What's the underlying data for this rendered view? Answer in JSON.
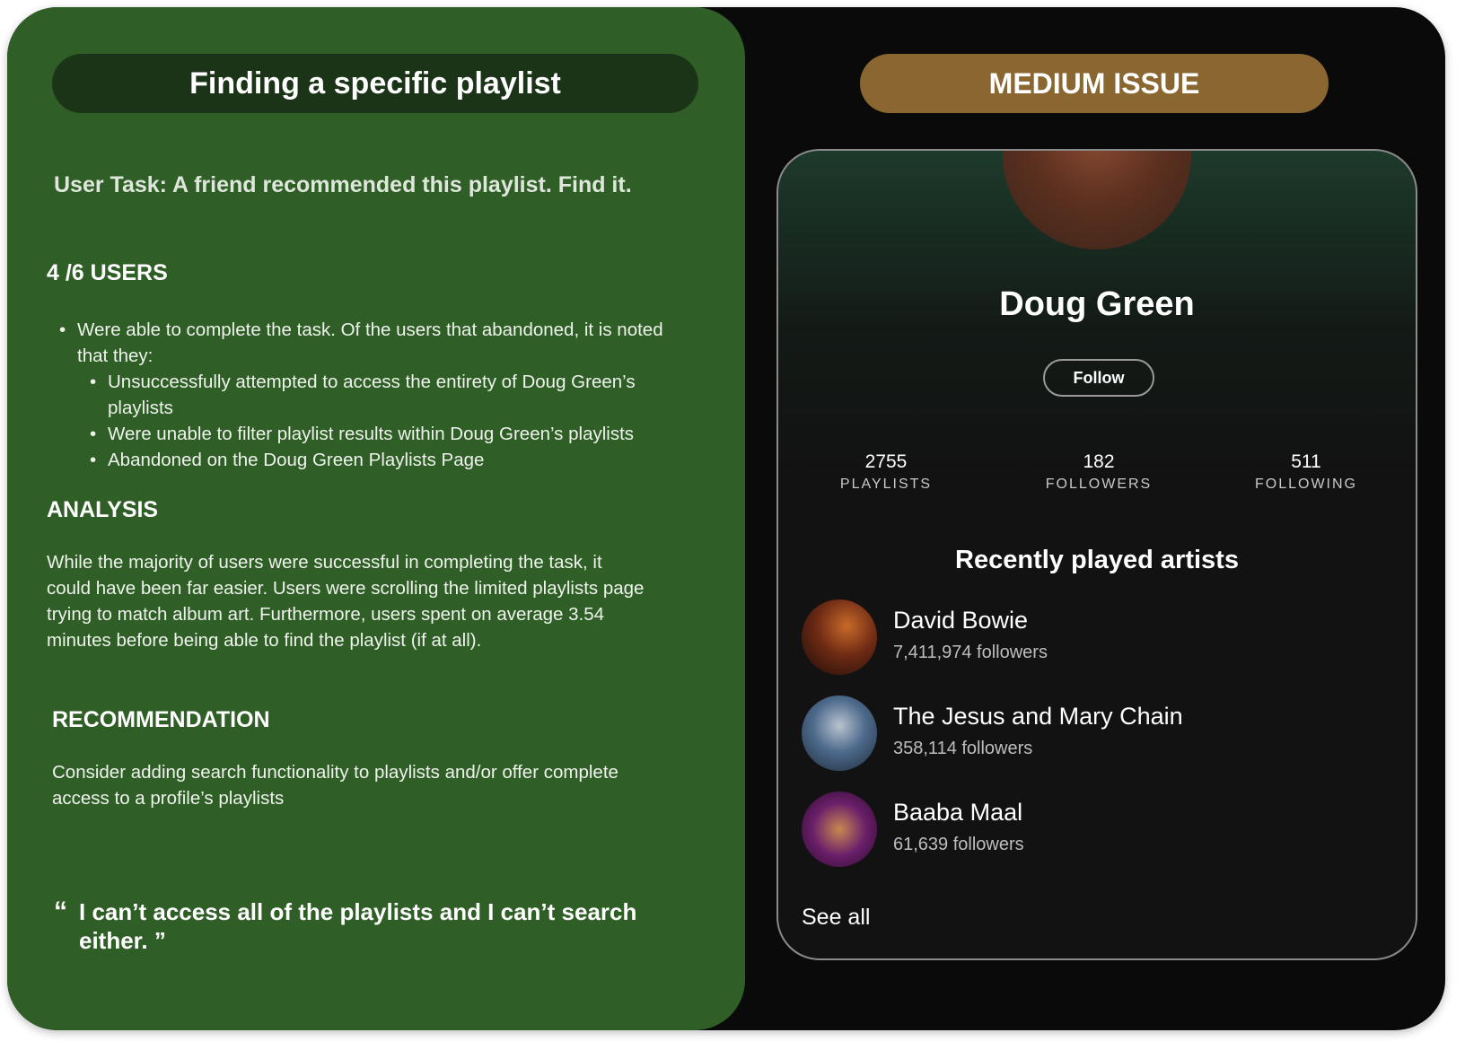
{
  "left": {
    "title": "Finding a specific playlist",
    "task": "User Task: A friend recommended this playlist.  Find it.",
    "users_heading": "4 /6 USERS",
    "bullet_main_line1": "Were able to complete the task. Of the users that abandoned, it is noted",
    "bullet_main_line2": "that they:",
    "sub_bullets": [
      "Unsuccessfully attempted to access the entirety of Doug Green’s",
      "playlists",
      "Were unable to filter playlist results within Doug Green’s playlists",
      "Abandoned on the Doug Green Playlists Page"
    ],
    "analysis_heading": "ANALYSIS",
    "analysis_lines": [
      "While the  majority of users were successful in completing the task, it",
      "could have been far easier. Users were scrolling the limited playlists page",
      "trying to match album art. Furthermore, users spent on average 3.54",
      "minutes before being able to find the playlist (if at all)."
    ],
    "recommendation_heading": "RECOMMENDATION",
    "recommendation_lines": [
      "Consider adding search functionality to playlists and/or offer complete",
      "access to a profile’s playlists"
    ],
    "quote_open": "“",
    "quote_line1": "I can’t access all of the playlists and I can’t search",
    "quote_line2": "either.",
    "quote_close": "”"
  },
  "right": {
    "badge": "MEDIUM ISSUE",
    "badge_color": "#8a6630",
    "profile": {
      "name": "Doug Green",
      "follow_label": "Follow",
      "stats": [
        {
          "number": "2755",
          "label": "PLAYLISTS"
        },
        {
          "number": "182",
          "label": "FOLLOWERS"
        },
        {
          "number": "511",
          "label": "FOLLOWING"
        }
      ],
      "recent_title": "Recently played artists",
      "artists": [
        {
          "name": "David Bowie",
          "followers": "7,411,974 followers"
        },
        {
          "name": "The Jesus and Mary Chain",
          "followers": "358,114 followers"
        },
        {
          "name": "Baaba Maal",
          "followers": "61,639 followers"
        }
      ],
      "see_all": "See all"
    }
  }
}
